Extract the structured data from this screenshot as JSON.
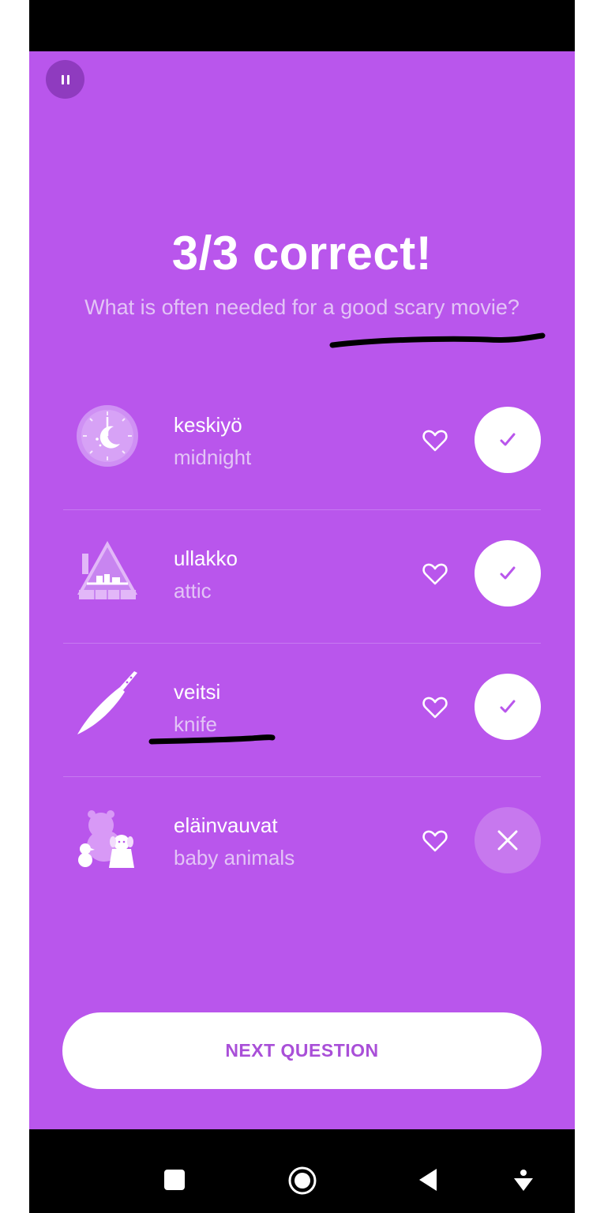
{
  "quiz": {
    "title": "3/3 correct!",
    "question": "What is often needed for a good scary movie?"
  },
  "items": [
    {
      "word": "keskiyö",
      "translation": "midnight",
      "result": "correct",
      "icon": "midnight-clock-icon"
    },
    {
      "word": "ullakko",
      "translation": "attic",
      "result": "correct",
      "icon": "attic-house-icon"
    },
    {
      "word": "veitsi",
      "translation": "knife",
      "result": "correct",
      "icon": "knife-icon"
    },
    {
      "word": "eläinvauvat",
      "translation": "baby animals",
      "result": "incorrect",
      "icon": "baby-animals-icon"
    }
  ],
  "buttons": {
    "next": "NEXT QUESTION"
  },
  "colors": {
    "background": "#b956ec",
    "accent_text": "#a94fd8",
    "subtle_text": "#e3c4f6"
  },
  "system_nav": [
    "recents-square-icon",
    "home-circle-icon",
    "back-triangle-icon",
    "accessibility-icon"
  ]
}
